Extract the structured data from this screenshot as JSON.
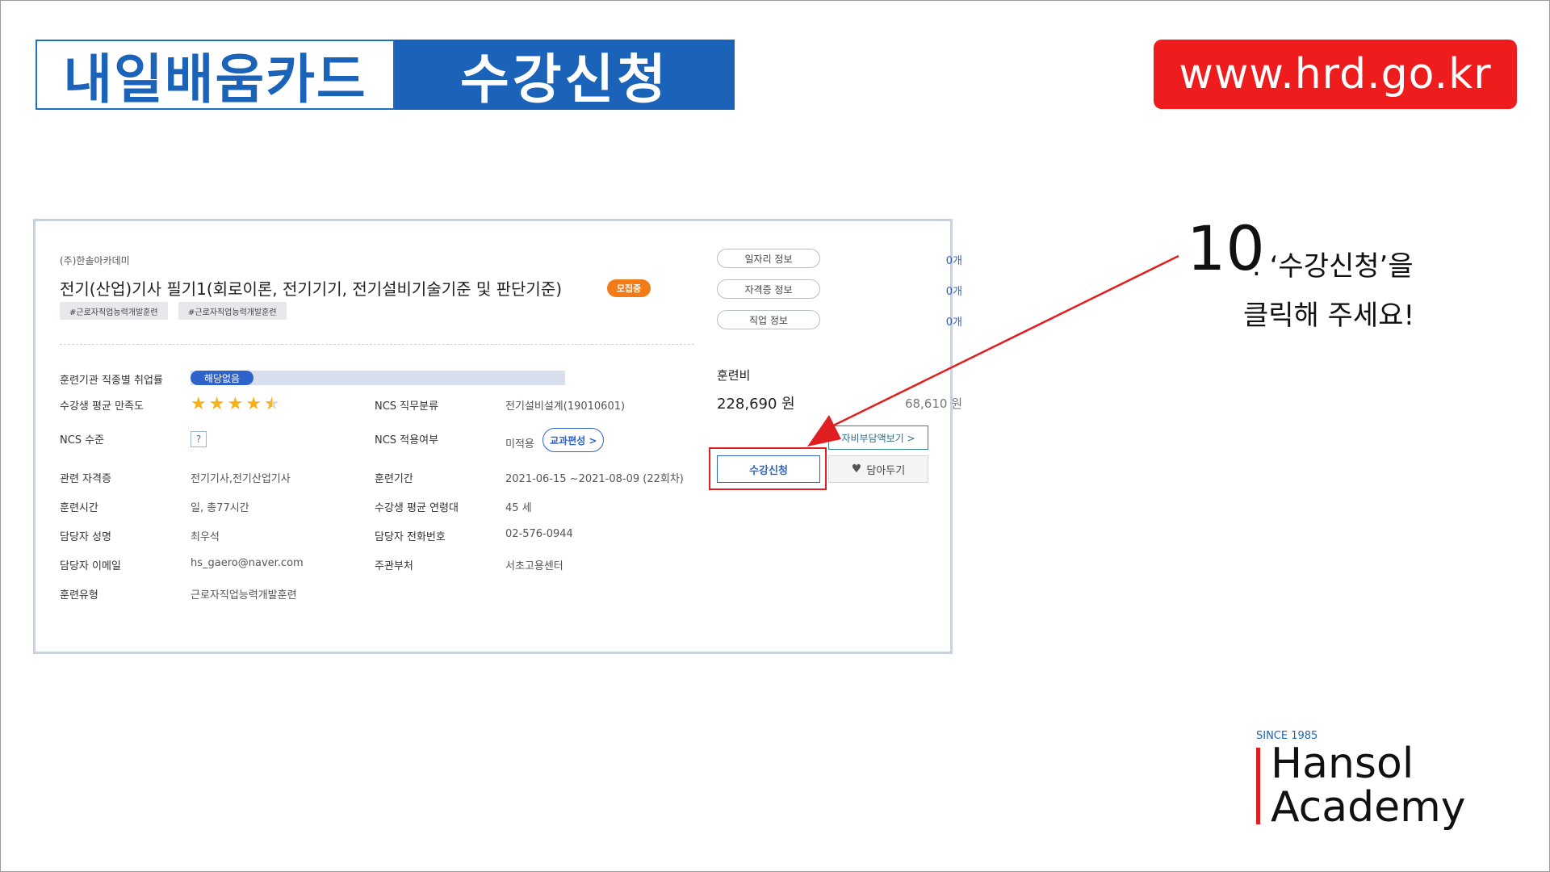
{
  "banner": {
    "left": "내일배움카드",
    "right": "수강신청"
  },
  "url": "www.hrd.go.kr",
  "course": {
    "academy": "(주)한솔아카데미",
    "title": "전기(산업)기사 필기1(회로이론, 전기기기, 전기설비기술기준 및 판단기준)",
    "status_badge": "모집중",
    "tags": [
      "#근로자직업능력개발훈련",
      "#근로자직업능력개발훈련"
    ],
    "employment": {
      "label": "훈련기관 직종별 취업률",
      "value": "해당없음"
    },
    "satisfaction": {
      "label": "수강생 평균 만족도",
      "rating": 4.5,
      "max": 5
    },
    "ncs_level": {
      "label": "NCS 수준",
      "value": "?"
    },
    "ncs_category": {
      "label": "NCS 직무분류",
      "value": "전기설비설계(19010601)"
    },
    "ncs_applied": {
      "label": "NCS 적용여부",
      "value": "미적용",
      "button": "교과편성 >"
    },
    "rows": [
      {
        "l1": "관련 자격증",
        "v1": "전기기사,전기산업기사",
        "l2": "훈련기간",
        "v2": "2021-06-15 ~2021-08-09 (22회차)"
      },
      {
        "l1": "훈련시간",
        "v1": "일, 총77시간",
        "l2": "수강생 평균 연령대",
        "v2": "45 세"
      },
      {
        "l1": "담당자 성명",
        "v1": "최우석",
        "l2": "담당자 전화번호",
        "v2": "02-576-0944"
      },
      {
        "l1": "담당자 이메일",
        "v1": "hs_gaero@naver.com",
        "l2": "주관부처",
        "v2": "서초고용센터"
      },
      {
        "l1": "훈련유형",
        "v1": "근로자직업능력개발훈련",
        "l2": "",
        "v2": ""
      }
    ]
  },
  "side": {
    "info": [
      {
        "label": "일자리 정보",
        "count": "0개"
      },
      {
        "label": "자격증 정보",
        "count": "0개"
      },
      {
        "label": "직업 정보",
        "count": "0개"
      }
    ],
    "fee_label": "훈련비",
    "fee_value": "228,690 원",
    "self_fee": "68,610 원",
    "self_button": "자비부담액보기 >",
    "apply_button": "수강신청",
    "save_button": "담아두기"
  },
  "instruction": {
    "number": "10",
    "line1": ". ‘수강신청’을",
    "line2": "클릭해 주세요!"
  },
  "logo": {
    "since": "SINCE 1985",
    "line1": "Hansol",
    "line2": "Academy"
  },
  "colors": {
    "brand_blue": "#1a63b8",
    "url_red": "#ee1c1c",
    "highlight_red": "#e02020",
    "badge_orange": "#f07b17"
  }
}
